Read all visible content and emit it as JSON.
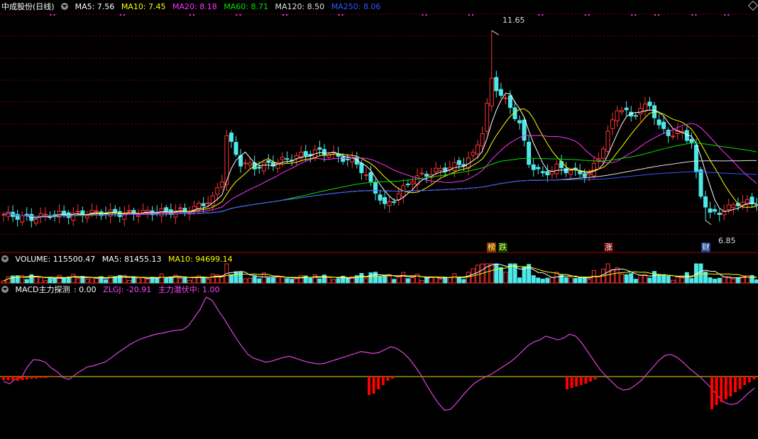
{
  "header": {
    "stock_name": "中成股份(日线)",
    "ma": [
      {
        "label": "MA5: 7.56",
        "color": "#ffffff"
      },
      {
        "label": "MA10: 7.45",
        "color": "#ffff00"
      },
      {
        "label": "MA20: 8.18",
        "color": "#ff33ff"
      },
      {
        "label": "MA60: 8.71",
        "color": "#00e000"
      },
      {
        "label": "MA120: 8.50",
        "color": "#e0e0e0"
      },
      {
        "label": "MA250: 8.06",
        "color": "#3355ff"
      }
    ]
  },
  "volume_header": {
    "title": "VOLUME: 115500.47",
    "ma5": "MA5: 81455.13",
    "ma10": "MA10: 94699.14"
  },
  "macd_header": {
    "title": "MACD主力探测",
    "value": ": 0.00",
    "zlgj": "ZLGJ: -20.91",
    "hidden": "主力潜伏中: 1.00"
  },
  "annotations": {
    "high": "11.65",
    "low": "6.85",
    "tags": [
      {
        "text": "榜",
        "bg": "#883300",
        "fg": "#ffff66"
      },
      {
        "text": "跌",
        "bg": "#004400",
        "fg": "#ffff66"
      },
      {
        "text": "涨",
        "bg": "#660000",
        "fg": "#ffffff"
      },
      {
        "text": "财",
        "bg": "#1a3a88",
        "fg": "#ffffff"
      }
    ]
  },
  "colors": {
    "up": "#ff3333",
    "down": "#4ee8e8",
    "grid": "#7a0000",
    "divider": "#b00000",
    "zlgj_line": "#dd44dd",
    "zero_line": "#dddd00"
  },
  "chart_data": [
    {
      "type": "candlestick",
      "title": "中成股份(日线)",
      "price_range": [
        6.2,
        12.1
      ],
      "note_high": 11.65,
      "note_low": 6.85,
      "candles_count": 133
    },
    {
      "type": "bar",
      "title": "VOLUME",
      "last": 115500.47,
      "ma5": 81455.13,
      "ma10": 94699.14
    },
    {
      "type": "line",
      "title": "MACD主力探测",
      "zlgj_last": -20.91,
      "zlgj_points": [
        [
          0,
          -10
        ],
        [
          5,
          -15
        ],
        [
          10,
          -5
        ],
        [
          15,
          -2
        ],
        [
          20,
          20
        ],
        [
          25,
          35
        ],
        [
          30,
          34
        ],
        [
          35,
          30
        ],
        [
          40,
          18
        ],
        [
          45,
          10
        ],
        [
          50,
          -2
        ],
        [
          55,
          -6
        ],
        [
          60,
          4
        ],
        [
          65,
          12
        ],
        [
          70,
          20
        ],
        [
          75,
          22
        ],
        [
          80,
          26
        ],
        [
          85,
          30
        ],
        [
          90,
          38
        ],
        [
          95,
          48
        ],
        [
          100,
          56
        ],
        [
          105,
          65
        ],
        [
          110,
          72
        ],
        [
          115,
          78
        ],
        [
          120,
          82
        ],
        [
          125,
          86
        ],
        [
          130,
          89
        ],
        [
          135,
          91
        ],
        [
          140,
          94
        ],
        [
          145,
          96
        ],
        [
          150,
          97
        ],
        [
          155,
          105
        ],
        [
          160,
          122
        ],
        [
          165,
          140
        ],
        [
          170,
          165
        ],
        [
          175,
          158
        ],
        [
          180,
          138
        ],
        [
          185,
          120
        ],
        [
          190,
          100
        ],
        [
          195,
          80
        ],
        [
          200,
          62
        ],
        [
          205,
          46
        ],
        [
          210,
          38
        ],
        [
          215,
          34
        ],
        [
          220,
          30
        ],
        [
          225,
          32
        ],
        [
          230,
          36
        ],
        [
          235,
          40
        ],
        [
          240,
          42
        ],
        [
          245,
          38
        ],
        [
          250,
          34
        ],
        [
          255,
          30
        ],
        [
          260,
          28
        ],
        [
          265,
          26
        ],
        [
          270,
          28
        ],
        [
          275,
          32
        ],
        [
          280,
          36
        ],
        [
          285,
          40
        ],
        [
          290,
          44
        ],
        [
          295,
          48
        ],
        [
          300,
          52
        ],
        [
          305,
          50
        ],
        [
          310,
          48
        ],
        [
          315,
          50
        ],
        [
          320,
          56
        ],
        [
          325,
          62
        ],
        [
          330,
          58
        ],
        [
          335,
          50
        ],
        [
          340,
          38
        ],
        [
          345,
          22
        ],
        [
          350,
          4
        ],
        [
          355,
          -18
        ],
        [
          360,
          -38
        ],
        [
          365,
          -56
        ],
        [
          370,
          -70
        ],
        [
          375,
          -68
        ],
        [
          380,
          -55
        ],
        [
          385,
          -40
        ],
        [
          390,
          -26
        ],
        [
          395,
          -14
        ],
        [
          400,
          -6
        ],
        [
          405,
          0
        ],
        [
          410,
          6
        ],
        [
          415,
          14
        ],
        [
          420,
          22
        ],
        [
          425,
          30
        ],
        [
          430,
          40
        ],
        [
          435,
          52
        ],
        [
          440,
          64
        ],
        [
          445,
          72
        ],
        [
          450,
          76
        ],
        [
          455,
          84
        ],
        [
          460,
          80
        ],
        [
          465,
          76
        ],
        [
          470,
          80
        ],
        [
          475,
          88
        ],
        [
          480,
          84
        ],
        [
          485,
          70
        ],
        [
          490,
          52
        ],
        [
          495,
          34
        ],
        [
          500,
          16
        ],
        [
          505,
          2
        ],
        [
          510,
          -10
        ],
        [
          515,
          -22
        ],
        [
          520,
          -28
        ],
        [
          525,
          -26
        ],
        [
          530,
          -18
        ],
        [
          535,
          -8
        ],
        [
          540,
          6
        ],
        [
          545,
          20
        ],
        [
          550,
          34
        ],
        [
          555,
          44
        ],
        [
          560,
          46
        ],
        [
          565,
          40
        ],
        [
          570,
          30
        ],
        [
          575,
          18
        ],
        [
          580,
          8
        ],
        [
          585,
          -2
        ],
        [
          590,
          -14
        ],
        [
          595,
          -28
        ],
        [
          600,
          -42
        ],
        [
          605,
          -54
        ],
        [
          610,
          -58
        ],
        [
          615,
          -56
        ],
        [
          620,
          -46
        ],
        [
          625,
          -34
        ],
        [
          630,
          -24
        ]
      ]
    }
  ]
}
